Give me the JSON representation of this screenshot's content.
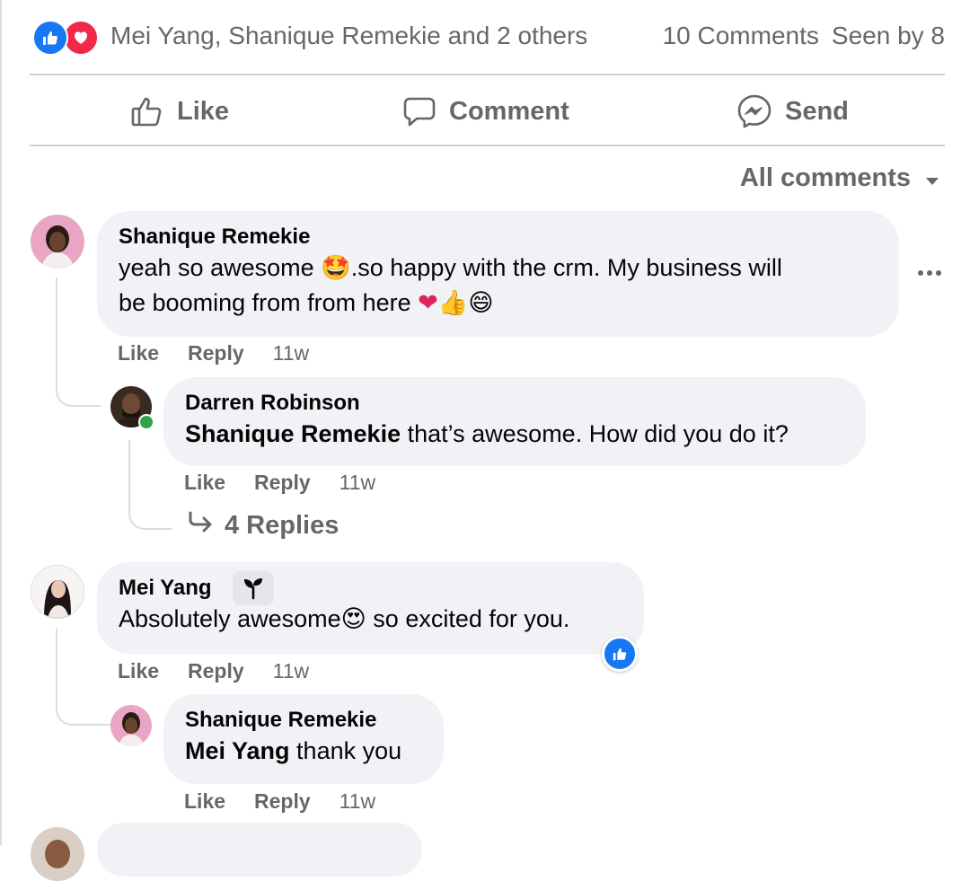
{
  "reactions": {
    "icons": [
      "like-icon",
      "love-icon"
    ],
    "summary": "Mei Yang, Shanique Remekie and 2 others",
    "comments_count": "10 Comments",
    "seen_by": "Seen by 8"
  },
  "actions": {
    "like": "Like",
    "comment": "Comment",
    "send": "Send"
  },
  "filter": {
    "label": "All comments"
  },
  "comments": [
    {
      "author": "Shanique Remekie",
      "text_a": "yeah so awesome ",
      "text_b": ".so happy with the crm. My business will",
      "text_c": "be booming from from here ",
      "like": "Like",
      "reply": "Reply",
      "time": "11w",
      "replies": [
        {
          "author": "Darren Robinson",
          "tag": "Shanique Remekie",
          "text": " that’s awesome. How did you do it?",
          "like": "Like",
          "reply": "Reply",
          "time": "11w"
        }
      ],
      "more_replies": "4 Replies"
    },
    {
      "author": "Mei Yang",
      "text_a": "Absolutely awesome",
      "text_b": " so excited for you.",
      "like": "Like",
      "reply": "Reply",
      "time": "11w",
      "replies": [
        {
          "author": "Shanique Remekie",
          "tag": "Mei Yang",
          "text": " thank you",
          "like": "Like",
          "reply": "Reply",
          "time": "11w"
        }
      ]
    }
  ],
  "colors": {
    "accent": "#1877f2",
    "love": "#f02849",
    "muted": "#65676b",
    "bubble": "#f0f2f5"
  }
}
